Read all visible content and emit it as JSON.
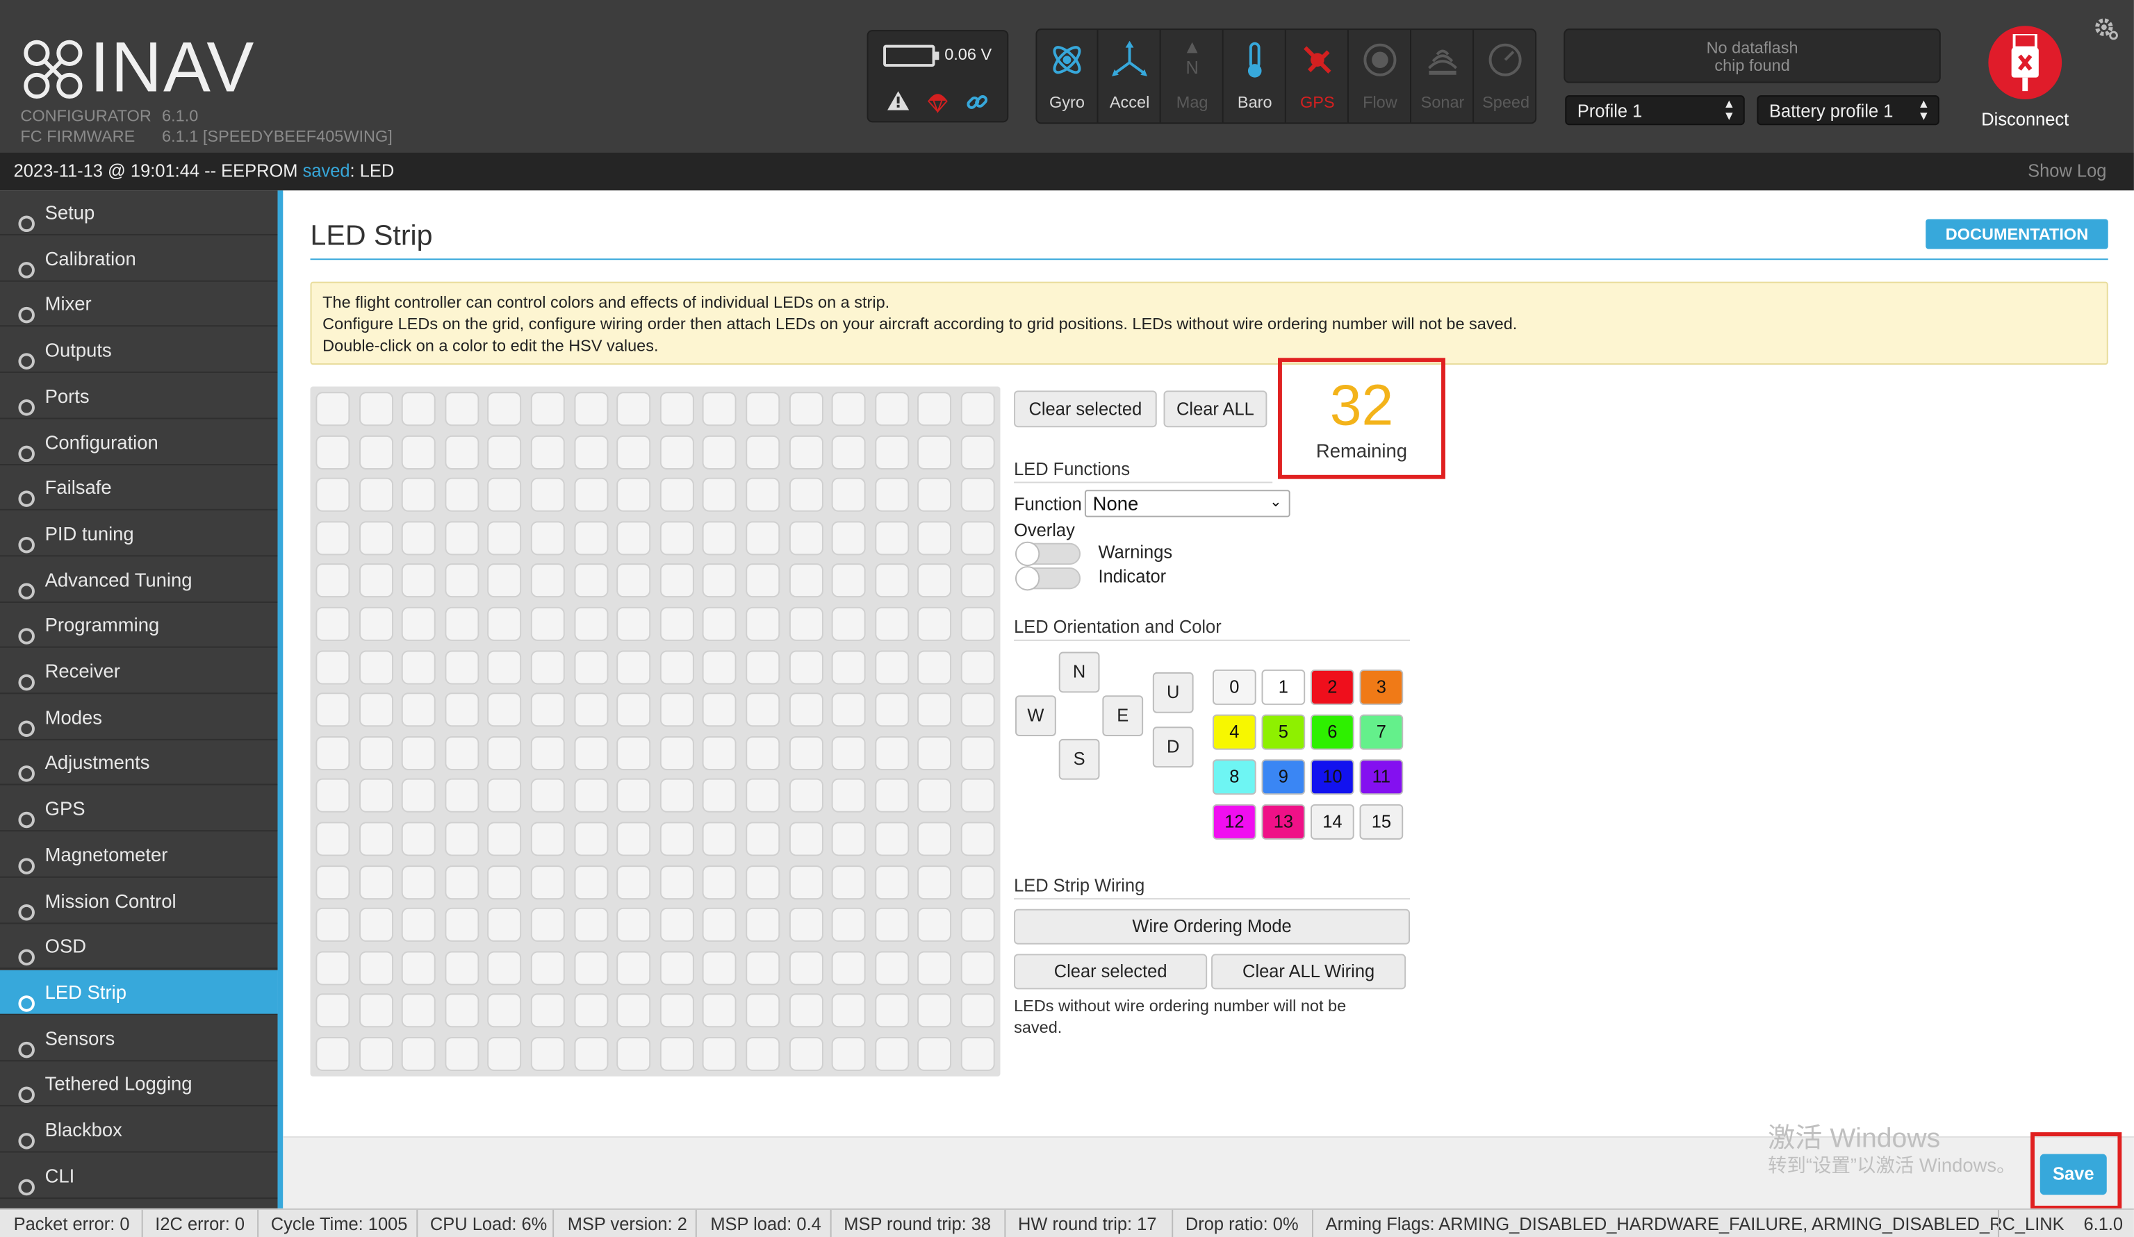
{
  "header": {
    "logo": "INAV",
    "configurator_label": "CONFIGURATOR",
    "configurator_version": "6.1.0",
    "fw_label": "FC FIRMWARE",
    "fw_version": "6.1.1 [SPEEDYBEEF405WING]",
    "battery_voltage": "0.06 V",
    "sensors": [
      {
        "name": "Gyro",
        "state": "active"
      },
      {
        "name": "Accel",
        "state": "active"
      },
      {
        "name": "Mag",
        "state": "inactive"
      },
      {
        "name": "Baro",
        "state": "active"
      },
      {
        "name": "GPS",
        "state": "error"
      },
      {
        "name": "Flow",
        "state": "inactive"
      },
      {
        "name": "Sonar",
        "state": "inactive"
      },
      {
        "name": "Speed",
        "state": "inactive"
      }
    ],
    "dataflash_line1": "No dataflash",
    "dataflash_line2": "chip found",
    "profile": "Profile 1",
    "battery_profile": "Battery profile 1",
    "disconnect_label": "Disconnect"
  },
  "status": {
    "timestamp": "2023-11-13 @ 19:01:44 -- EEPROM ",
    "saved": "saved",
    "suffix": ": LED",
    "show_log": "Show Log"
  },
  "sidebar": {
    "items": [
      "Setup",
      "Calibration",
      "Mixer",
      "Outputs",
      "Ports",
      "Configuration",
      "Failsafe",
      "PID tuning",
      "Advanced Tuning",
      "Programming",
      "Receiver",
      "Modes",
      "Adjustments",
      "GPS",
      "Magnetometer",
      "Mission Control",
      "OSD",
      "LED Strip",
      "Sensors",
      "Tethered Logging",
      "Blackbox",
      "CLI"
    ],
    "active": "LED Strip"
  },
  "page": {
    "title": "LED Strip",
    "doc_button": "DOCUMENTATION",
    "info_line1": "The flight controller can control colors and effects of individual LEDs on a strip.",
    "info_line2": "Configure LEDs on the grid, configure wiring order then attach LEDs on your aircraft according to grid positions. LEDs without wire ordering number will not be saved.",
    "info_line3": "Double-click on a color to edit the HSV values."
  },
  "controls": {
    "clear_selected": "Clear selected",
    "clear_all": "Clear ALL",
    "remaining_count": "32",
    "remaining_label": "Remaining",
    "functions_title": "LED Functions",
    "function_label": "Function",
    "function_value": "None",
    "overlay_label": "Overlay",
    "warnings_label": "Warnings",
    "indicator_label": "Indicator",
    "orientation_title": "LED Orientation and Color",
    "directions": {
      "n": "N",
      "w": "W",
      "e": "E",
      "s": "S",
      "u": "U",
      "d": "D"
    },
    "colors": [
      {
        "label": "0",
        "bg": "#f5f5f5"
      },
      {
        "label": "1",
        "bg": "#ffffff"
      },
      {
        "label": "2",
        "bg": "#ef0f1c"
      },
      {
        "label": "3",
        "bg": "#f07a17"
      },
      {
        "label": "4",
        "bg": "#f7f700"
      },
      {
        "label": "5",
        "bg": "#8ef000"
      },
      {
        "label": "6",
        "bg": "#2ef000"
      },
      {
        "label": "7",
        "bg": "#64f08b"
      },
      {
        "label": "8",
        "bg": "#6ef5f3"
      },
      {
        "label": "9",
        "bg": "#3a86f4"
      },
      {
        "label": "10",
        "bg": "#1212ef"
      },
      {
        "label": "11",
        "bg": "#8410f0"
      },
      {
        "label": "12",
        "bg": "#f00ef0"
      },
      {
        "label": "13",
        "bg": "#ef1187"
      },
      {
        "label": "14",
        "bg": "#f1f1f1"
      },
      {
        "label": "15",
        "bg": "#f1f1f1"
      }
    ],
    "wiring_title": "LED Strip Wiring",
    "wire_mode": "Wire Ordering Mode",
    "wire_clear_selected": "Clear selected",
    "wire_clear_all": "Clear ALL Wiring",
    "wiring_note_1": "LEDs without wire ordering number will not be",
    "wiring_note_2": "saved."
  },
  "grid": {
    "rows": 16,
    "cols": 16
  },
  "footer": {
    "watermark_1": "激活 Windows",
    "watermark_2": "转到“设置”以激活 Windows。",
    "save": "Save"
  },
  "bottom": {
    "items": [
      "Packet error: 0",
      "I2C error: 0",
      "Cycle Time: 1005",
      "CPU Load: 6%",
      "MSP version: 2",
      "MSP load: 0.4",
      "MSP round trip: 38",
      "HW round trip: 17",
      "Drop ratio: 0%",
      "Arming Flags: ARMING_DISABLED_HARDWARE_FAILURE, ARMING_DISABLED_RC_LINK"
    ],
    "version": "6.1.0"
  },
  "colors": {
    "accent": "#37a8db",
    "highlight": "#e02020",
    "remaining": "#f3b31a"
  }
}
